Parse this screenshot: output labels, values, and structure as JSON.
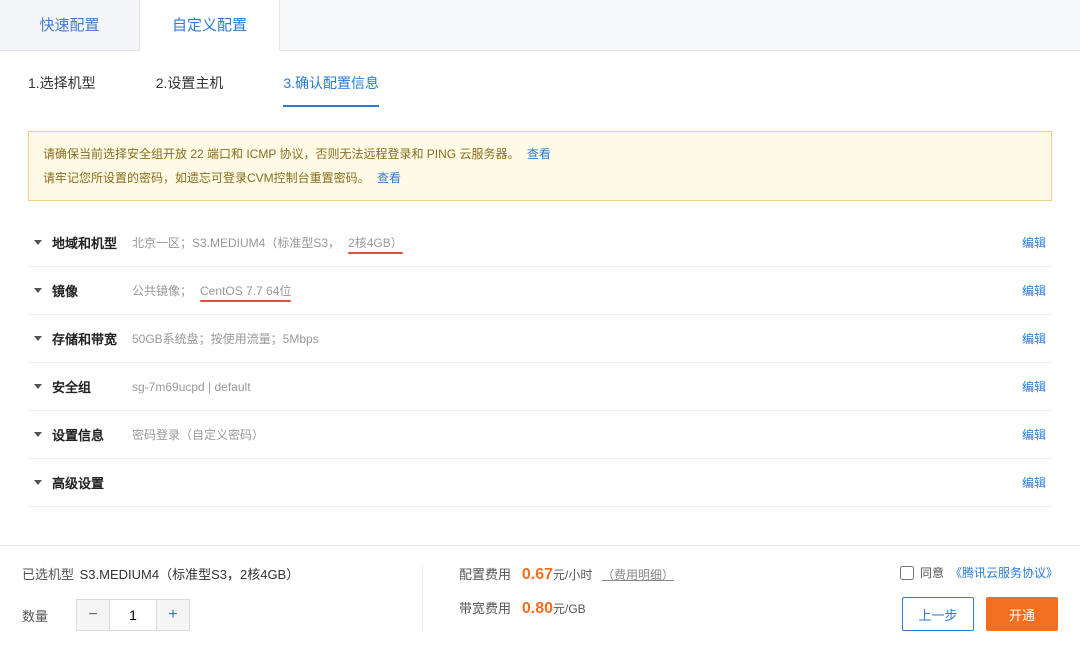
{
  "topTabs": {
    "quick": "快速配置",
    "custom": "自定义配置"
  },
  "steps": {
    "s1": "1.选择机型",
    "s2": "2.设置主机",
    "s3": "3.确认配置信息"
  },
  "warning": {
    "line1_a": "请确保当前选择安全组开放 22 端口和 ICMP 协议，否则无法远程登录和 PING 云服务器。",
    "line2_a": "请牢记您所设置的密码，如遗忘可登录CVM控制台重置密码。",
    "view": "查看"
  },
  "sections": [
    {
      "title": "地域和机型",
      "detail_a": "北京一区；S3.MEDIUM4（标准型S3，",
      "detail_b": "2核4GB）",
      "edit": "编辑",
      "underline": true,
      "underline_mode": "b"
    },
    {
      "title": "镜像",
      "detail_a": "公共镜像；",
      "detail_b": "CentOS 7.7 64位",
      "edit": "编辑",
      "underline": true,
      "underline_mode": "b"
    },
    {
      "title": "存储和带宽",
      "detail_a": "50GB系统盘；按使用流量；5Mbps",
      "detail_b": "",
      "edit": "编辑",
      "underline": false
    },
    {
      "title": "安全组",
      "detail_a": "sg-7m69ucpd | default",
      "detail_b": "",
      "edit": "编辑",
      "underline": false
    },
    {
      "title": "设置信息",
      "detail_a": "密码登录（自定义密码）",
      "detail_b": "",
      "edit": "编辑",
      "underline": false
    },
    {
      "title": "高级设置",
      "detail_a": "",
      "detail_b": "",
      "edit": "编辑",
      "underline": false
    }
  ],
  "footer": {
    "selectedLabel": "已选机型",
    "selectedValue": "S3.MEDIUM4（标准型S3，2核4GB）",
    "quantityLabel": "数量",
    "quantityValue": "1",
    "configFeeLabel": "配置费用",
    "configFeeNum": "0.67",
    "configFeeUnit": "元/小时",
    "feeDetail": "（费用明细）",
    "bwFeeLabel": "带宽费用",
    "bwFeeNum": "0.80",
    "bwFeeUnit": "元/GB",
    "agreeLabel": "同意",
    "agreementLink": "《腾讯云服务协议》",
    "prevBtn": "上一步",
    "submitBtn": "开通"
  }
}
